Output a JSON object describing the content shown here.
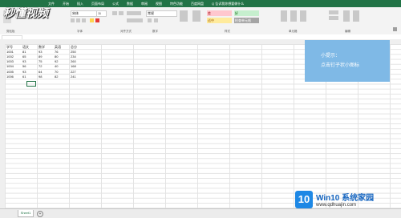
{
  "ribbon": {
    "tabs": [
      "文件",
      "开始",
      "插入",
      "页面布局",
      "公式",
      "数据",
      "审阅",
      "视图",
      "特色功能",
      "百度网盘",
      "Q 告诉我你想要做什么"
    ],
    "font_name": "宋体",
    "font_size": "11",
    "number_format": "常规",
    "style_cells": {
      "bad": "差",
      "good": "好",
      "normal": "适中",
      "check": "检查单元格"
    },
    "group_labels": [
      "剪贴板",
      "字体",
      "对齐方式",
      "数字",
      "样式",
      "单元格",
      "编辑"
    ]
  },
  "watermark": {
    "text": "秒懂视频"
  },
  "table": {
    "headers": [
      "学号",
      "语文",
      "数学",
      "英语",
      "总分"
    ],
    "rows": [
      [
        "1001",
        "81",
        "93",
        "76",
        "250"
      ],
      [
        "1002",
        "65",
        "89",
        "80",
        "234"
      ],
      [
        "1003",
        "93",
        "75",
        "92",
        "260"
      ],
      [
        "1004",
        "56",
        "72",
        "40",
        "168"
      ],
      [
        "1005",
        "93",
        "64",
        "70",
        "227"
      ],
      [
        "1006",
        "61",
        "98",
        "82",
        "241"
      ]
    ]
  },
  "tip": {
    "title": "小提示：",
    "body": "点击钉子状小图标"
  },
  "sheet": {
    "tab_label": "Sheet1"
  },
  "brand": {
    "logo_text": "10",
    "title": "Win10 系统家园",
    "url": "www.qdhuajin.com"
  },
  "colors": {
    "excel_green": "#217346",
    "tip_bg": "#7fb9e6",
    "bad_fill": "#ffc7ce",
    "good_fill": "#c6efce",
    "neutral_fill": "#ffeb9c"
  }
}
